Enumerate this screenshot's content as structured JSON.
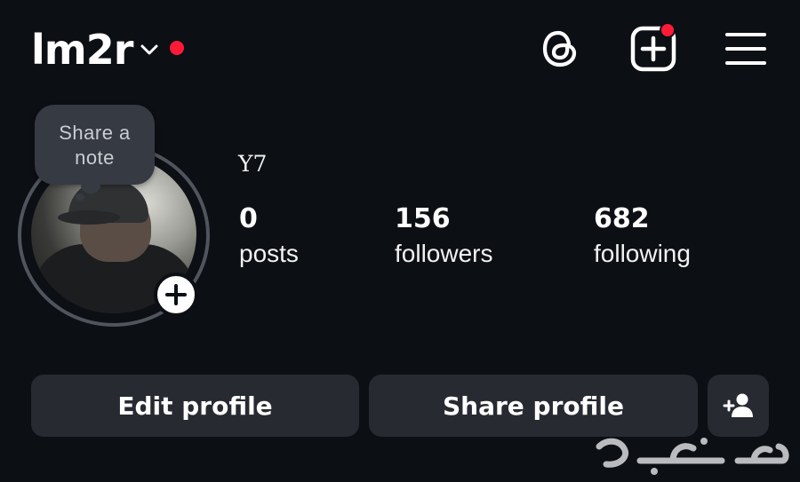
{
  "header": {
    "username": "lm2r",
    "icons": {
      "chevron": "chevron-down-icon",
      "threads": "threads-icon",
      "new_post": "new-post-icon",
      "menu": "menu-icon"
    },
    "colors": {
      "notification_dot": "#ff1a38",
      "background": "#0c0f14"
    }
  },
  "profile": {
    "note_prompt_line1": "Share a",
    "note_prompt_line2": "note",
    "display_name": "Y7",
    "stats": {
      "posts_count": "0",
      "posts_label": "posts",
      "followers_count": "156",
      "followers_label": "followers",
      "following_count": "682",
      "following_label": "following"
    }
  },
  "actions": {
    "edit_label": "Edit profile",
    "share_label": "Share profile",
    "add_user_icon": "add-user-icon",
    "button_color": "#272a31"
  }
}
